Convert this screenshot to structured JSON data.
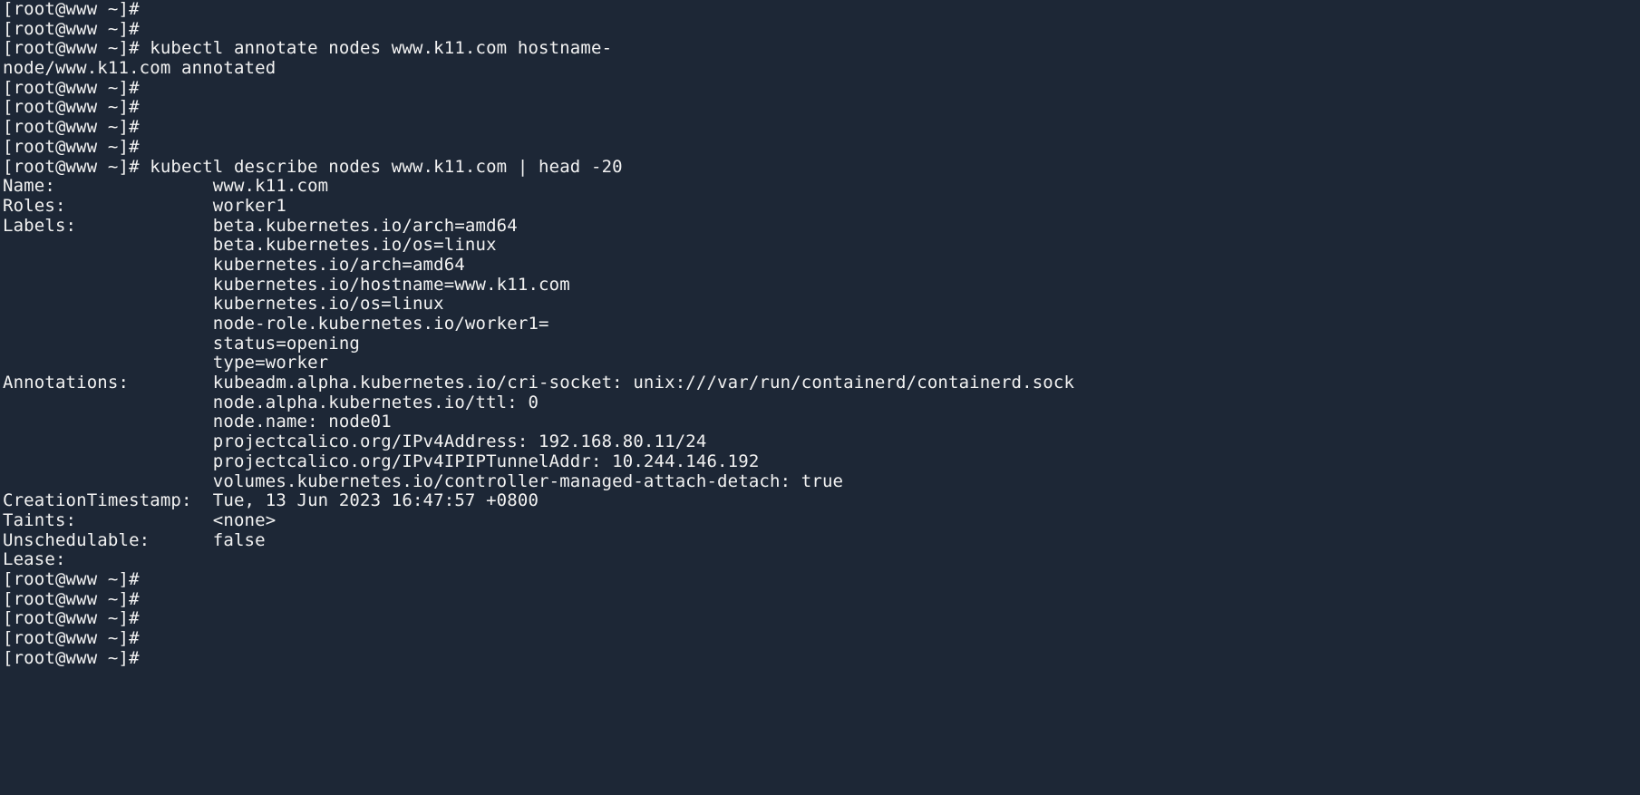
{
  "terminal": {
    "app": "linux-terminal",
    "background_color": "#1d2736",
    "foreground_color": "#f2f2f2",
    "prompt": "[root@www ~]#",
    "hostname": "www",
    "user": "root",
    "cwd": "~",
    "commands": [
      "kubectl annotate nodes www.k11.com hostname-",
      "kubectl describe nodes www.k11.com | head -20"
    ],
    "lines": [
      "[root@www ~]#",
      "[root@www ~]#",
      "[root@www ~]# kubectl annotate nodes www.k11.com hostname-",
      "node/www.k11.com annotated",
      "[root@www ~]#",
      "[root@www ~]#",
      "[root@www ~]#",
      "[root@www ~]#",
      "[root@www ~]# kubectl describe nodes www.k11.com | head -20",
      "Name:               www.k11.com",
      "Roles:              worker1",
      "Labels:             beta.kubernetes.io/arch=amd64",
      "                    beta.kubernetes.io/os=linux",
      "                    kubernetes.io/arch=amd64",
      "                    kubernetes.io/hostname=www.k11.com",
      "                    kubernetes.io/os=linux",
      "                    node-role.kubernetes.io/worker1=",
      "                    status=opening",
      "                    type=worker",
      "Annotations:        kubeadm.alpha.kubernetes.io/cri-socket: unix:///var/run/containerd/containerd.sock",
      "                    node.alpha.kubernetes.io/ttl: 0",
      "                    node.name: node01",
      "                    projectcalico.org/IPv4Address: 192.168.80.11/24",
      "                    projectcalico.org/IPv4IPIPTunnelAddr: 10.244.146.192",
      "                    volumes.kubernetes.io/controller-managed-attach-detach: true",
      "CreationTimestamp:  Tue, 13 Jun 2023 16:47:57 +0800",
      "Taints:             <none>",
      "Unschedulable:      false",
      "Lease:",
      "[root@www ~]#",
      "[root@www ~]#",
      "[root@www ~]#",
      "[root@www ~]#",
      "[root@www ~]#"
    ],
    "node_description": {
      "name_label": "Name:",
      "name_value": "www.k11.com",
      "roles_label": "Roles:",
      "roles_value": "worker1",
      "labels_label": "Labels:",
      "labels_values": [
        "beta.kubernetes.io/arch=amd64",
        "beta.kubernetes.io/os=linux",
        "kubernetes.io/arch=amd64",
        "kubernetes.io/hostname=www.k11.com",
        "kubernetes.io/os=linux",
        "node-role.kubernetes.io/worker1=",
        "status=opening",
        "type=worker"
      ],
      "annotations_label": "Annotations:",
      "annotations_values": [
        "kubeadm.alpha.kubernetes.io/cri-socket: unix:///var/run/containerd/containerd.sock",
        "node.alpha.kubernetes.io/ttl: 0",
        "node.name: node01",
        "projectcalico.org/IPv4Address: 192.168.80.11/24",
        "projectcalico.org/IPv4IPIPTunnelAddr: 10.244.146.192",
        "volumes.kubernetes.io/controller-managed-attach-detach: true"
      ],
      "creation_timestamp_label": "CreationTimestamp:",
      "creation_timestamp_value": "Tue, 13 Jun 2023 16:47:57 +0800",
      "taints_label": "Taints:",
      "taints_value": "<none>",
      "unschedulable_label": "Unschedulable:",
      "unschedulable_value": "false",
      "lease_label": "Lease:"
    },
    "command_output": {
      "annotate_result": "node/www.k11.com annotated"
    }
  }
}
